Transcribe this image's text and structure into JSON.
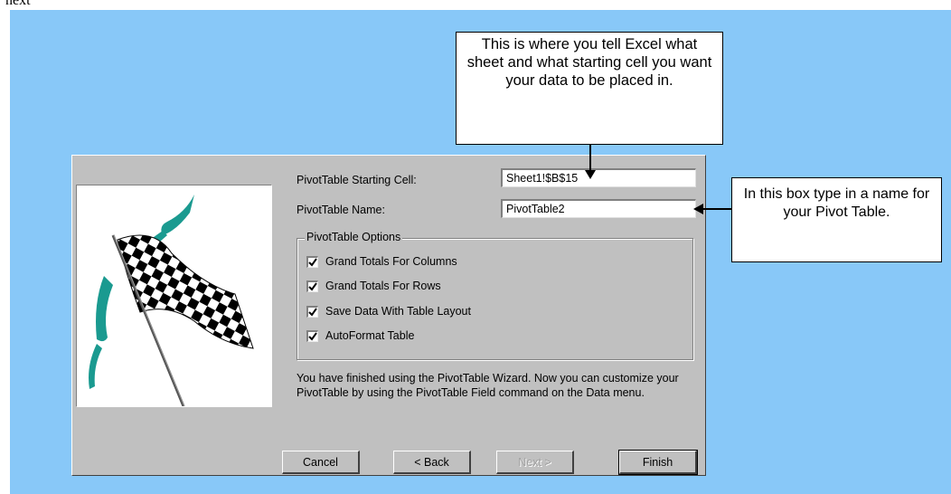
{
  "page_fragment": "next",
  "dialog": {
    "starting_cell_label": "PivotTable Starting Cell:",
    "starting_cell_value": "Sheet1!$B$15",
    "name_label": "PivotTable Name:",
    "name_value": "PivotTable2",
    "options_title": "PivotTable Options",
    "options": [
      {
        "label": "Grand Totals For Columns",
        "checked": true
      },
      {
        "label": "Grand Totals For Rows",
        "checked": true
      },
      {
        "label": "Save Data With Table Layout",
        "checked": true
      },
      {
        "label": "AutoFormat Table",
        "checked": true
      }
    ],
    "description": "You have finished using the PivotTable Wizard.  Now you can customize your PivotTable by using the PivotTable Field command on the Data menu.",
    "buttons": {
      "cancel": "Cancel",
      "back": "< Back",
      "next": "Next >",
      "finish": "Finish"
    }
  },
  "callouts": {
    "top": "This is where you tell Excel what sheet and what starting cell you want your data to be placed in.",
    "right": "In this box type in a name for your Pivot Table."
  },
  "colors": {
    "background": "#88c8f8",
    "dialog_face": "#c0c0c0",
    "flag_teal": "#1a9a90"
  }
}
